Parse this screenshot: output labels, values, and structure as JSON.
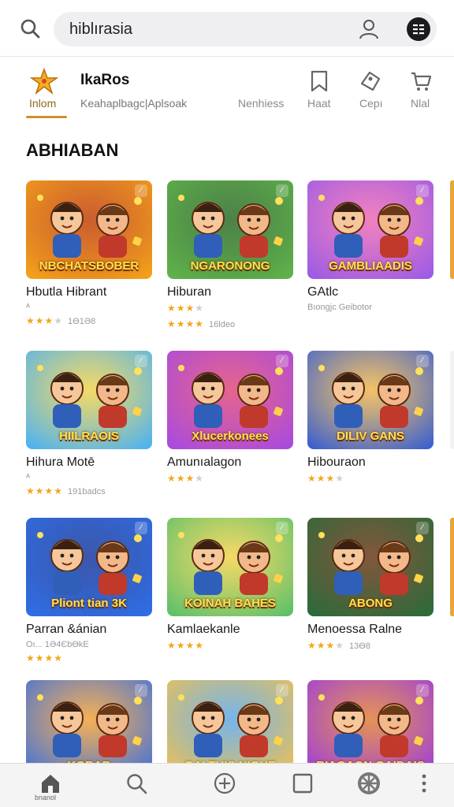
{
  "search": {
    "query": "hiblırasia"
  },
  "header": {
    "brand_title": "IkaRos",
    "brand_subtitle": "Keahaplbagc|Aplsoak",
    "home_label": "Inlom",
    "tabs": [
      {
        "label": "Nenhiess",
        "icon": ""
      },
      {
        "label": "Haat",
        "icon": "bookmark-icon"
      },
      {
        "label": "Cepı",
        "icon": "tag-icon"
      },
      {
        "label": "Nlal",
        "icon": "cart-icon"
      }
    ]
  },
  "section": {
    "title": "ABHIABAN"
  },
  "cards": [
    {
      "caption": "NBCHATSBOBER",
      "title": "Hbutla Hibrant",
      "meta": "ᴬ",
      "rating": 3,
      "count": "1Ө1Ә8",
      "colors": [
        "#f4a21b",
        "#c2410c"
      ]
    },
    {
      "caption": "NGARONONG",
      "title": "Hiburan",
      "meta": "",
      "rating": 3,
      "count": "",
      "rating2": 4,
      "count2": "16ldeo",
      "colors": [
        "#5fb34a",
        "#2f6b2a"
      ]
    },
    {
      "caption": "GAMBLIAADIS",
      "title": "GAtlc",
      "meta": "Bıongjc Geibotor",
      "rating": 0,
      "count": "",
      "colors": [
        "#9b5be6",
        "#f06bb4"
      ]
    },
    {
      "caption": "HIILRAOIS",
      "title": "Hihura Motē",
      "meta": "ᴬ",
      "rating": 4,
      "count": "191badcs",
      "colors": [
        "#4cb2f2",
        "#f2d34c"
      ]
    },
    {
      "caption": "Xlucerkonees",
      "title": "Amunıalagon",
      "meta": "",
      "rating": 3,
      "count": "",
      "colors": [
        "#a84ae0",
        "#e04a7a"
      ]
    },
    {
      "caption": "DILIV GANS",
      "title": "Hibouraon",
      "meta": "",
      "rating": 3,
      "count": "",
      "colors": [
        "#3a5fcf",
        "#f2b84c"
      ]
    },
    {
      "caption": "Pliont tian 3K",
      "title": "Parran &ánian",
      "meta": "Oı... 1Ә4ЄbӨkЕ",
      "rating": 4,
      "count": "",
      "colors": [
        "#2f6ee6",
        "#1a3a9c"
      ]
    },
    {
      "caption": "KOINAH BAHES",
      "title": "Kamlaekanle",
      "meta": "",
      "rating": 4,
      "count": "",
      "colors": [
        "#5cc06a",
        "#f2d34c"
      ]
    },
    {
      "caption": "ABONG",
      "title": "Menoessa Ralne",
      "meta": "",
      "rating": 3,
      "count": "13Ө8",
      "colors": [
        "#2b6b3a",
        "#6b3a1b"
      ]
    },
    {
      "caption": "KOBAB",
      "title": "",
      "meta": "",
      "rating": 0,
      "count": "",
      "colors": [
        "#3a6fe0",
        "#f2a23a"
      ]
    },
    {
      "caption": "GALTUIS NIGHE",
      "title": "",
      "meta": "",
      "rating": 0,
      "count": "",
      "colors": [
        "#f2c14c",
        "#5fa8e6"
      ]
    },
    {
      "caption": "RIAGAON GAIDAIS",
      "title": "",
      "meta": "",
      "rating": 0,
      "count": "",
      "colors": [
        "#9b3ae0",
        "#e0803a"
      ]
    }
  ],
  "bottom_nav": [
    {
      "icon": "home-icon",
      "label": "bnanol"
    },
    {
      "icon": "search-icon",
      "label": ""
    },
    {
      "icon": "plus-icon",
      "label": ""
    },
    {
      "icon": "square-icon",
      "label": ""
    },
    {
      "icon": "wheel-icon",
      "label": ""
    },
    {
      "icon": "more-icon",
      "label": ""
    }
  ],
  "colors": {
    "accent": "#c9922b",
    "star": "#f0a81c"
  }
}
